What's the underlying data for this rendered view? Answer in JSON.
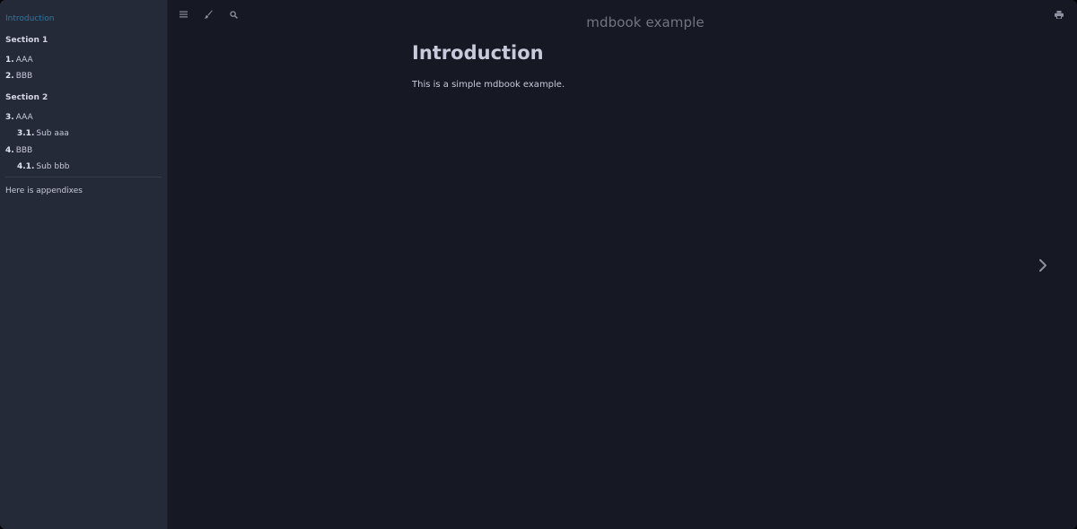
{
  "book": {
    "title": "mdbook example"
  },
  "toolbar": {
    "icons": [
      "bars-icon",
      "paintbrush-icon",
      "search-icon",
      "print-icon"
    ]
  },
  "sidebar": {
    "items": [
      {
        "label": "Introduction",
        "active": true
      },
      {
        "section": "Section 1"
      },
      {
        "num": "1.",
        "label": "AAA"
      },
      {
        "num": "2.",
        "label": "BBB"
      },
      {
        "section": "Section 2"
      },
      {
        "num": "3.",
        "label": "AAA"
      },
      {
        "num": "3.1.",
        "label": "Sub aaa"
      },
      {
        "num": "4.",
        "label": "BBB"
      },
      {
        "num": "4.1.",
        "label": "Sub bbb"
      },
      {
        "label": "Here is appendixes"
      }
    ]
  },
  "page": {
    "heading": "Introduction",
    "body": "This is a simple mdbook example."
  },
  "colors": {
    "sidebar_bg": "#252a39",
    "content_bg": "#161923",
    "active_link": "#2b79a2",
    "text": "#c8c9db"
  }
}
